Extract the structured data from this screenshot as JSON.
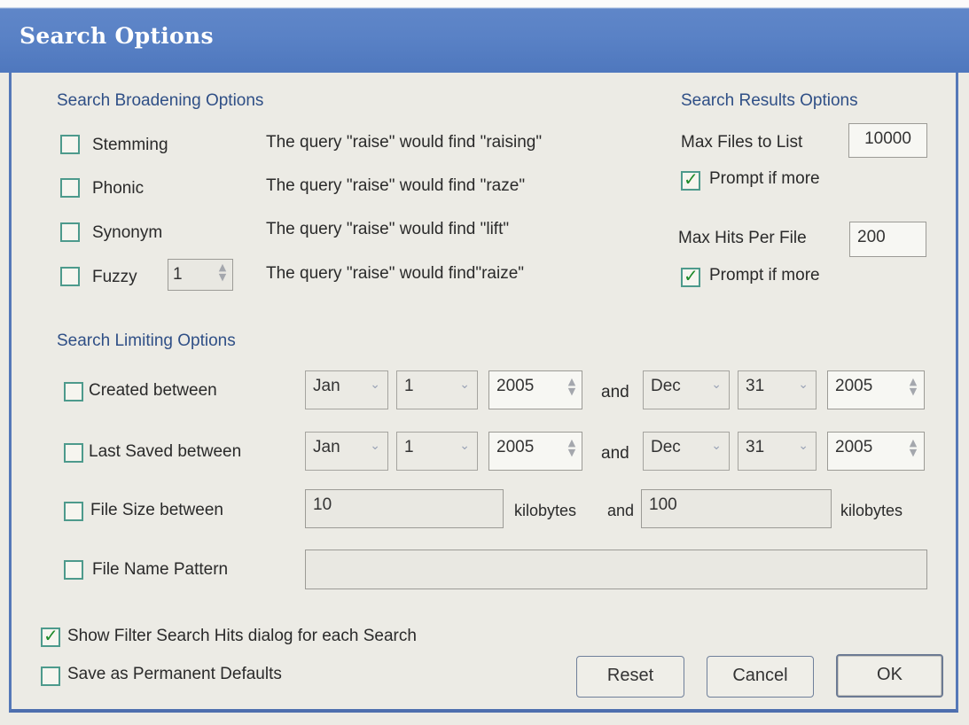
{
  "window": {
    "title": "Search Options"
  },
  "broadening": {
    "heading": "Search Broadening Options",
    "stemming": {
      "label": "Stemming",
      "checked": false,
      "description": "The query \"raise\" would find \"raising\""
    },
    "phonic": {
      "label": "Phonic",
      "checked": false,
      "description": "The query \"raise\" would find \"raze\""
    },
    "synonym": {
      "label": "Synonym",
      "checked": false,
      "description": "The query \"raise\" would find \"lift\""
    },
    "fuzzy": {
      "label": "Fuzzy",
      "checked": false,
      "value": "1",
      "description": "The query \"raise\" would find\"raize\""
    }
  },
  "results": {
    "heading": "Search Results Options",
    "max_files_label": "Max Files to List",
    "max_files_value": "10000",
    "prompt_files_label": "Prompt if more",
    "prompt_files_checked": true,
    "max_hits_label": "Max Hits Per File",
    "max_hits_value": "200",
    "prompt_hits_label": "Prompt if more",
    "prompt_hits_checked": true
  },
  "limiting": {
    "heading": "Search Limiting Options",
    "and_label": "and",
    "created": {
      "label": "Created between",
      "checked": false,
      "from": {
        "month": "Jan",
        "day": "1",
        "year": "2005"
      },
      "to": {
        "month": "Dec",
        "day": "31",
        "year": "2005"
      }
    },
    "last_saved": {
      "label": "Last Saved between",
      "checked": false,
      "from": {
        "month": "Jan",
        "day": "1",
        "year": "2005"
      },
      "to": {
        "month": "Dec",
        "day": "31",
        "year": "2005"
      }
    },
    "file_size": {
      "label": "File Size between",
      "checked": false,
      "from": "10",
      "to": "100",
      "unit_label": "kilobytes"
    },
    "file_name": {
      "label": "File Name Pattern",
      "checked": false,
      "value": ""
    }
  },
  "footer": {
    "show_filter_label": "Show Filter Search Hits dialog for each Search",
    "show_filter_checked": true,
    "save_defaults_label": "Save as Permanent Defaults",
    "save_defaults_checked": false,
    "reset_label": "Reset",
    "cancel_label": "Cancel",
    "ok_label": "OK"
  },
  "icons": {
    "dropdown": "chevron-down-icon",
    "spinner": "spinner-arrows-icon",
    "checkmark": "checkmark-icon"
  },
  "colors": {
    "title_bar": "#5a82c6",
    "section_heading": "#2f4f86",
    "checkbox_border": "#4d9a8c",
    "check_mark": "#1e8a2a"
  }
}
